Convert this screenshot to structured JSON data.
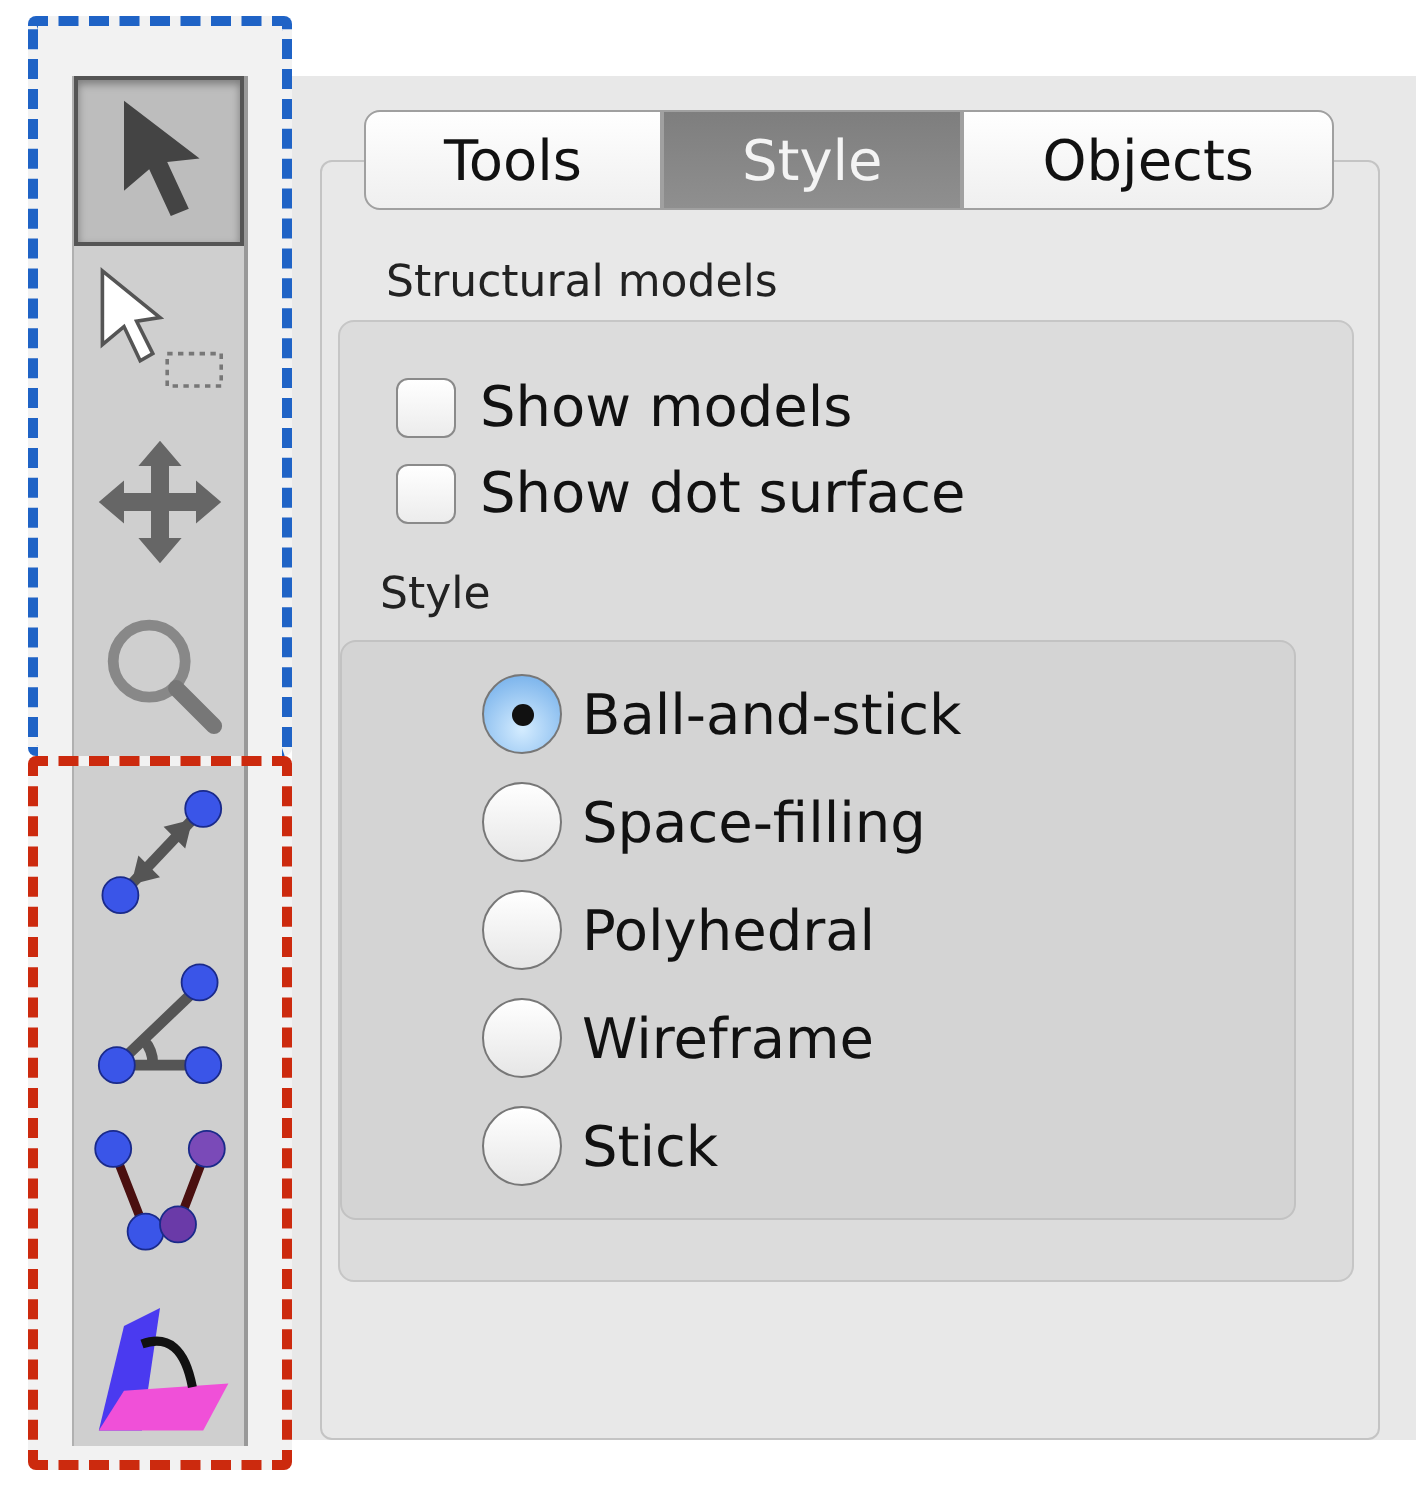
{
  "toolbar": {
    "groups": [
      {
        "color": "#1f63c6",
        "tools": [
          {
            "kind": "pointer",
            "selected": true
          },
          {
            "kind": "marquee",
            "selected": false
          },
          {
            "kind": "move",
            "selected": false
          },
          {
            "kind": "zoom",
            "selected": false
          }
        ]
      },
      {
        "color": "#cc2a0e",
        "tools": [
          {
            "kind": "distance",
            "selected": false
          },
          {
            "kind": "angle",
            "selected": false
          },
          {
            "kind": "torsion",
            "selected": false
          },
          {
            "kind": "plane",
            "selected": false
          }
        ]
      }
    ]
  },
  "tabs": [
    {
      "label": "Tools",
      "selected": false
    },
    {
      "label": "Style",
      "selected": true
    },
    {
      "label": "Objects",
      "selected": false
    }
  ],
  "section_title": "Structural models",
  "checkboxes": [
    {
      "label": "Show models",
      "checked": false
    },
    {
      "label": "Show dot surface",
      "checked": false
    }
  ],
  "style_group": {
    "title": "Style",
    "options": [
      {
        "label": "Ball-and-stick",
        "selected": true
      },
      {
        "label": "Space-filling",
        "selected": false
      },
      {
        "label": "Polyhedral",
        "selected": false
      },
      {
        "label": "Wireframe",
        "selected": false
      },
      {
        "label": "Stick",
        "selected": false
      }
    ]
  }
}
